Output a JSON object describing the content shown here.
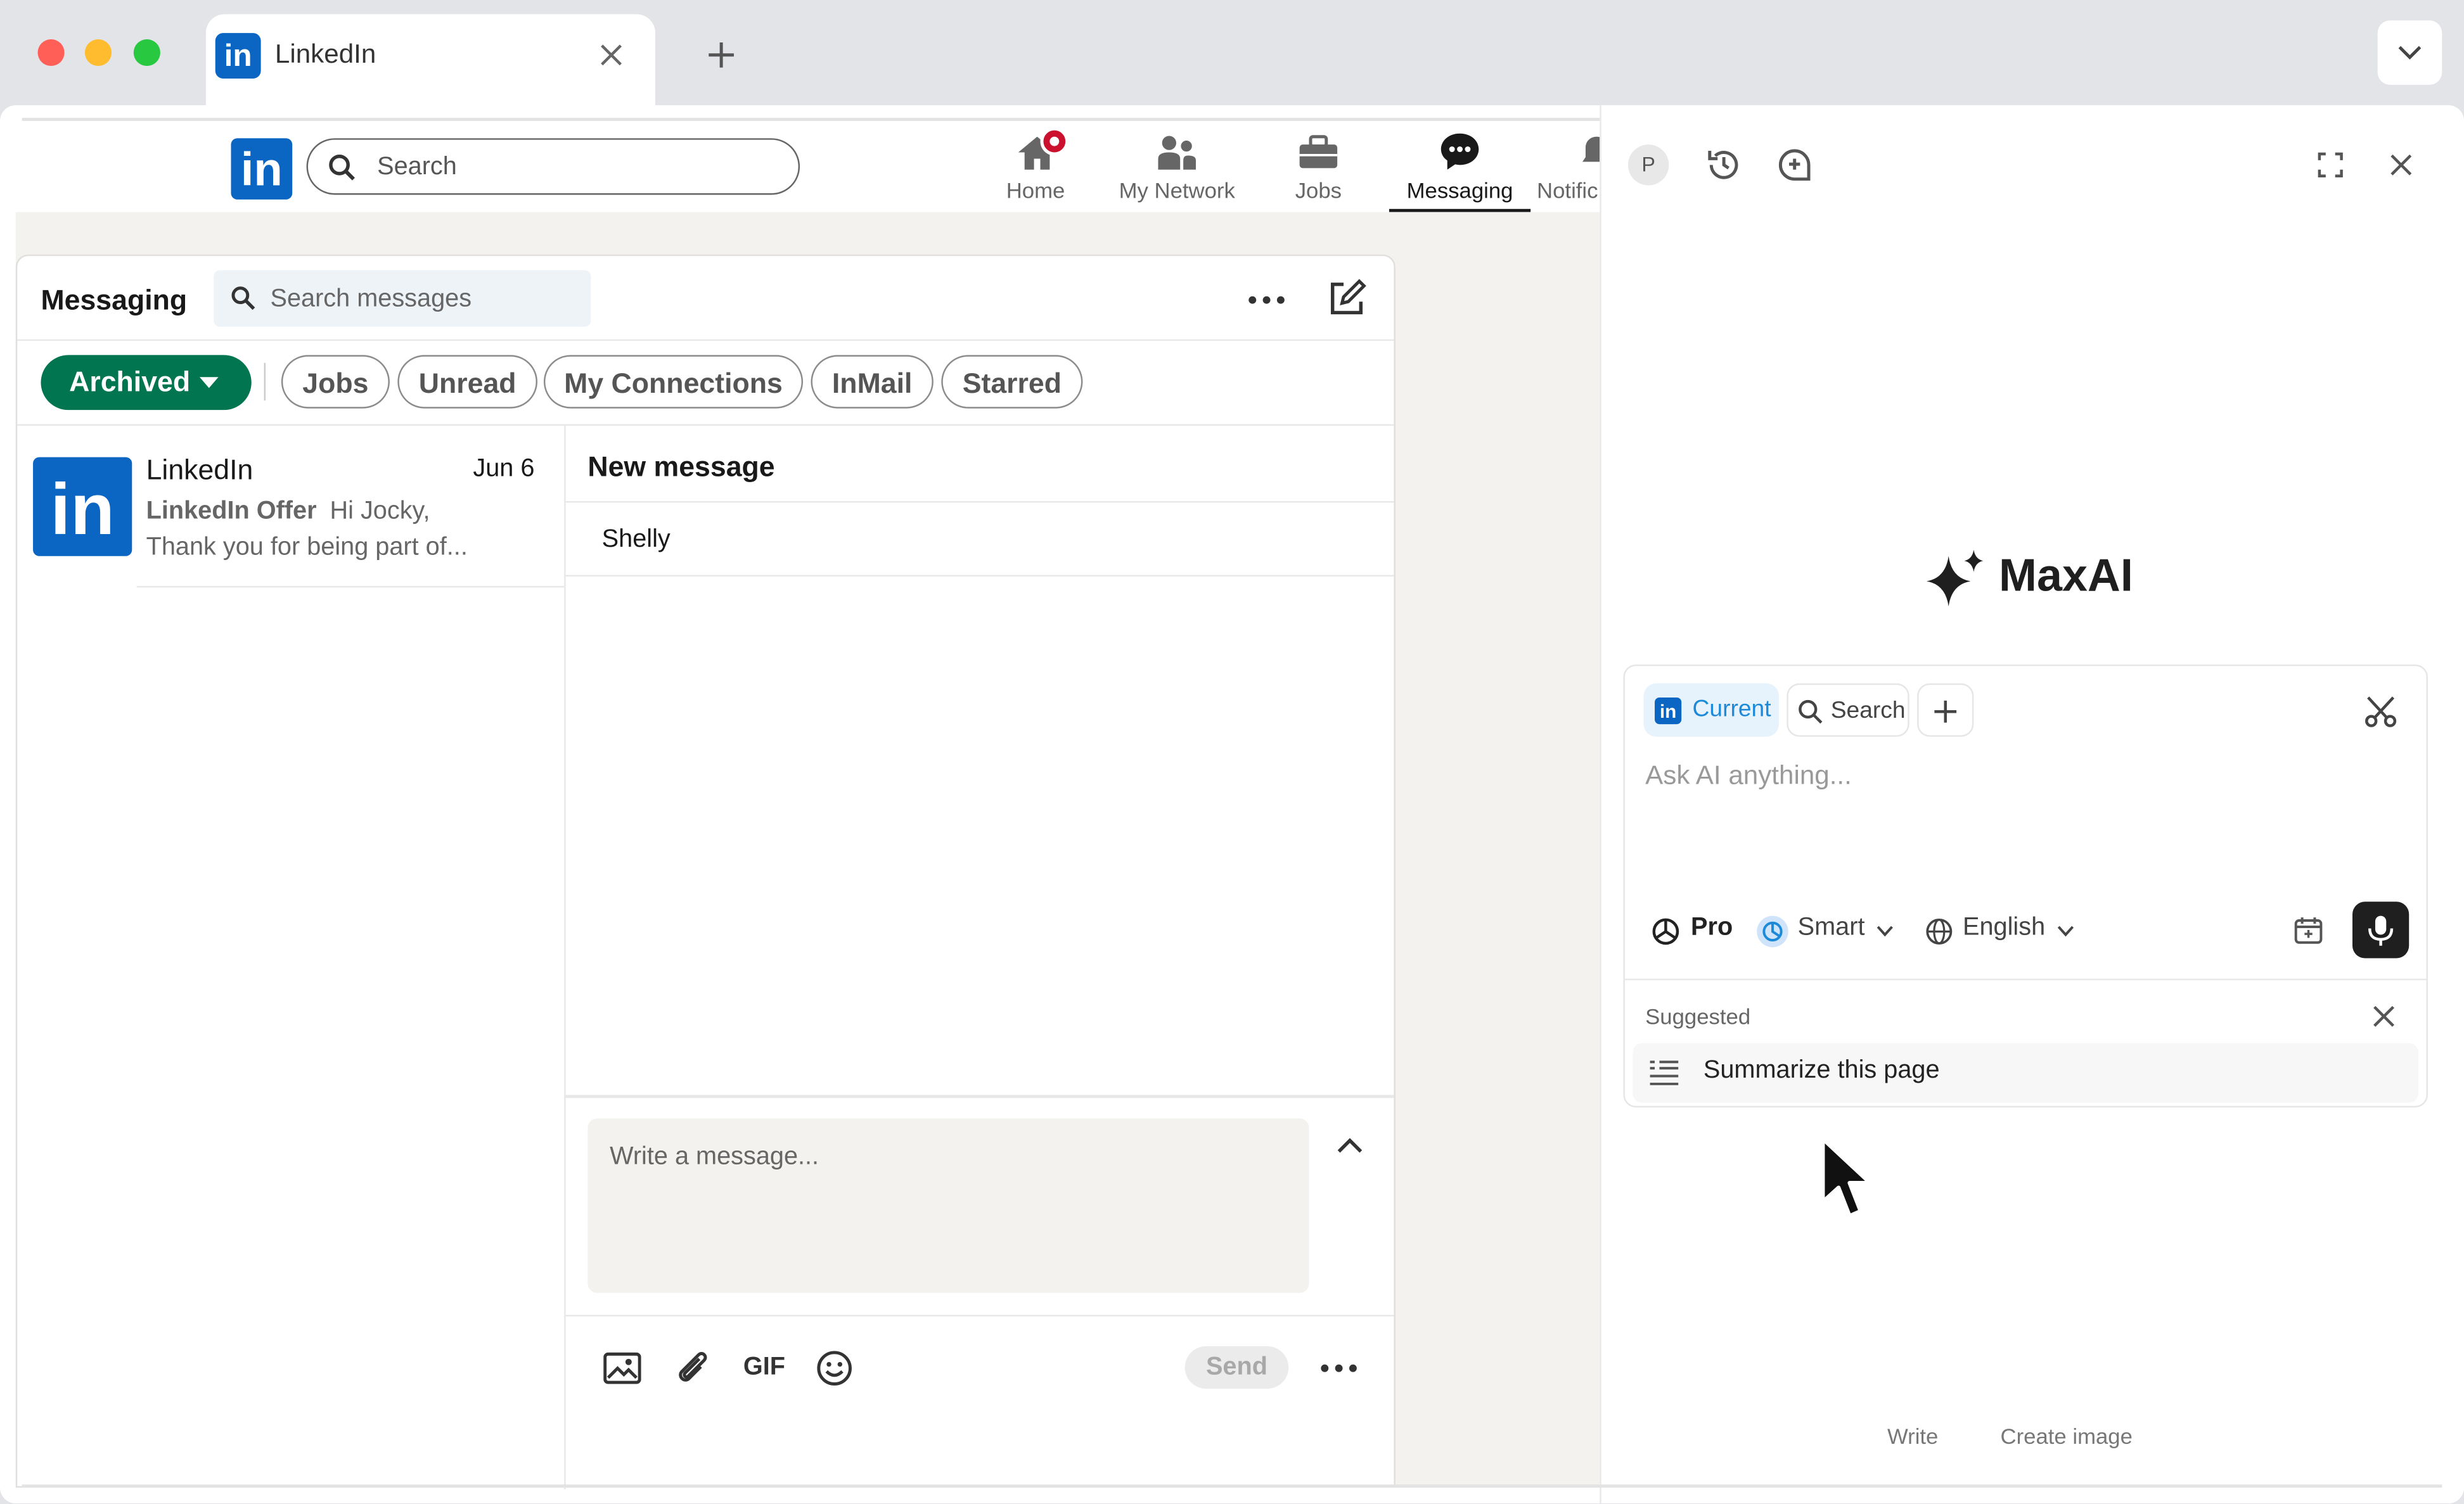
{
  "browser": {
    "tab_title": "LinkedIn",
    "colors": {
      "close": "#ff5f57",
      "minimize": "#febc2e",
      "maximize": "#28c840"
    }
  },
  "linkedin": {
    "brand_color": "#0a66c2",
    "search_placeholder": "Search",
    "nav": [
      {
        "label": "Home",
        "icon": "home-icon",
        "badge": true
      },
      {
        "label": "My Network",
        "icon": "people-icon"
      },
      {
        "label": "Jobs",
        "icon": "briefcase-icon"
      },
      {
        "label": "Messaging",
        "icon": "messaging-icon",
        "active": true
      },
      {
        "label": "Notific",
        "icon": "bell-icon"
      }
    ],
    "messaging": {
      "title": "Messaging",
      "search_placeholder": "Search messages",
      "filters": {
        "archived": "Archived",
        "items": [
          "Jobs",
          "Unread",
          "My Connections",
          "InMail",
          "Starred"
        ]
      },
      "conversation": {
        "name": "LinkedIn",
        "date": "Jun 6",
        "sender": "LinkedIn Offer",
        "preview_1": "Hi Jocky,",
        "preview_2": "Thank you for being part of..."
      },
      "compose": {
        "title": "New message",
        "recipient": "Shelly",
        "placeholder": "Write a message...",
        "gif_label": "GIF",
        "send_label": "Send"
      }
    }
  },
  "maxai": {
    "avatar_letter": "P",
    "brand": "MaxAI",
    "context_chips": {
      "current": "Current",
      "search": "Search"
    },
    "input_placeholder": "Ask AI anything...",
    "tier": "Pro",
    "model": "Smart",
    "language": "English",
    "suggested_title": "Suggested",
    "suggestion": "Summarize this page",
    "bottom_tabs": [
      "Write",
      "Create image"
    ],
    "accent": "#1c8ad8"
  }
}
